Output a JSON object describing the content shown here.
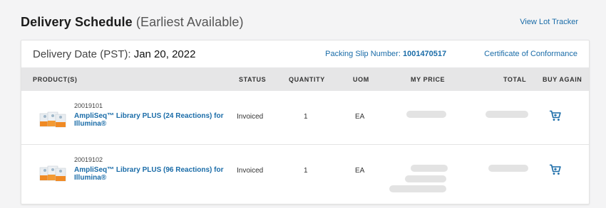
{
  "header": {
    "title": "Delivery Schedule",
    "subtitle": "(Earliest Available)",
    "lot_tracker_link": "View Lot Tracker"
  },
  "card": {
    "delivery_label": "Delivery Date (PST):",
    "delivery_value": "Jan 20, 2022",
    "packing_slip_label": "Packing Slip Number:",
    "packing_slip_value": "1001470517",
    "certificate_link": "Certificate of Conformance"
  },
  "table": {
    "columns": {
      "product": "PRODUCT(S)",
      "status": "STATUS",
      "quantity": "QUANTITY",
      "uom": "UOM",
      "my_price": "MY PRICE",
      "total": "TOTAL",
      "buy_again": "BUY AGAIN"
    },
    "rows": [
      {
        "sku": "20019101",
        "name": "AmpliSeq™ Library PLUS (24 Reactions) for Illumina®",
        "status": "Invoiced",
        "quantity": "1",
        "uom": "EA"
      },
      {
        "sku": "20019102",
        "name": "AmpliSeq™ Library PLUS (96 Reactions) for Illumina®",
        "status": "Invoiced",
        "quantity": "1",
        "uom": "EA"
      }
    ]
  },
  "icons": {
    "cart": "cart-icon",
    "product_image": "product-box-image"
  },
  "colors": {
    "link": "#1a6ca8",
    "header_bg": "#e6e6e7",
    "page_bg": "#f4f4f5"
  }
}
